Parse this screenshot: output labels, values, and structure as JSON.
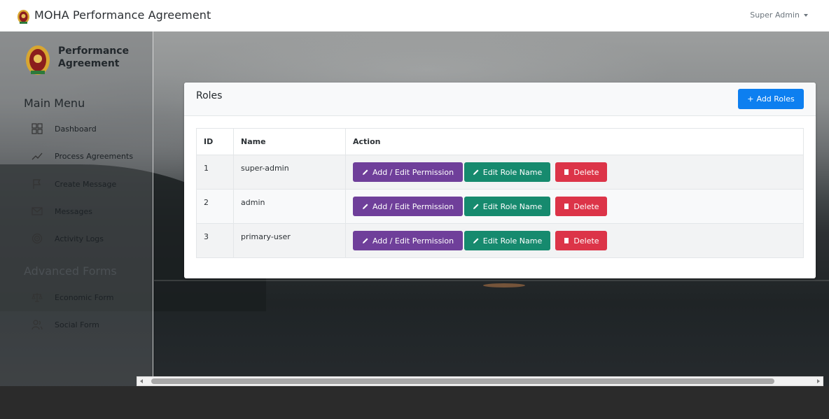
{
  "navbar": {
    "title": "MOHA Performance Agreement",
    "user": "Super Admin"
  },
  "sidebar": {
    "brand": "Performance Agreement",
    "main_heading": "Main Menu",
    "main_items": [
      {
        "label": "Dashboard",
        "icon": "dashboard-icon"
      },
      {
        "label": "Process Agreements",
        "icon": "trend-line-icon"
      },
      {
        "label": "Create Message",
        "icon": "flag-icon"
      },
      {
        "label": "Messages",
        "icon": "envelope-icon"
      },
      {
        "label": "Activity Logs",
        "icon": "target-icon"
      }
    ],
    "advanced_heading": "Advanced Forms",
    "advanced_items": [
      {
        "label": "Economic Form",
        "icon": "scale-icon"
      },
      {
        "label": "Social Form",
        "icon": "people-icon"
      }
    ]
  },
  "roles_card": {
    "title": "Roles",
    "add_button": "Add Roles",
    "columns": [
      "ID",
      "Name",
      "Action"
    ],
    "rows": [
      {
        "id": "1",
        "name": "super-admin"
      },
      {
        "id": "2",
        "name": "admin"
      },
      {
        "id": "3",
        "name": "primary-user"
      }
    ],
    "actions": {
      "permission": "Add / Edit Permission",
      "rename": "Edit Role Name",
      "delete": "Delete"
    }
  },
  "colors": {
    "primary": "#0d7ff0",
    "permission": "#6f3f9a",
    "rename": "#168a6e",
    "delete": "#dc3448"
  }
}
